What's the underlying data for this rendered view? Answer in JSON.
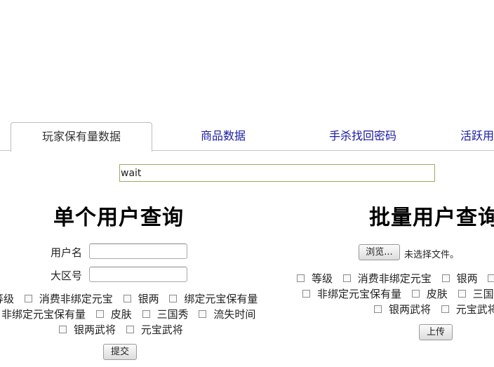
{
  "tabs": [
    {
      "label": "玩家保有量数据",
      "active": true
    },
    {
      "label": "商品数据",
      "active": false
    },
    {
      "label": "手杀找回密码",
      "active": false
    },
    {
      "label": "活跃用户",
      "active": false
    }
  ],
  "status_input": {
    "value": "wait"
  },
  "single": {
    "title": "单个用户查询",
    "username_label": "用户名",
    "region_label": "大区号",
    "row1": [
      "等级",
      "消费非绑定元宝",
      "银两",
      "绑定元宝保有量"
    ],
    "row2": [
      "非绑定元宝保有量",
      "皮肤",
      "三国秀",
      "流失时间"
    ],
    "row3": [
      "银两武将",
      "元宝武将"
    ],
    "submit_label": "提交"
  },
  "batch": {
    "title": "批量用户查询",
    "browse_label": "浏览...",
    "no_file_text": "未选择文件。",
    "row1": [
      "等级",
      "消费非绑定元宝",
      "银两",
      ""
    ],
    "row2": [
      "非绑定元宝保有量",
      "皮肤",
      "三国秀"
    ],
    "row3": [
      "银两武将",
      "元宝武将"
    ],
    "upload_label": "上传"
  }
}
